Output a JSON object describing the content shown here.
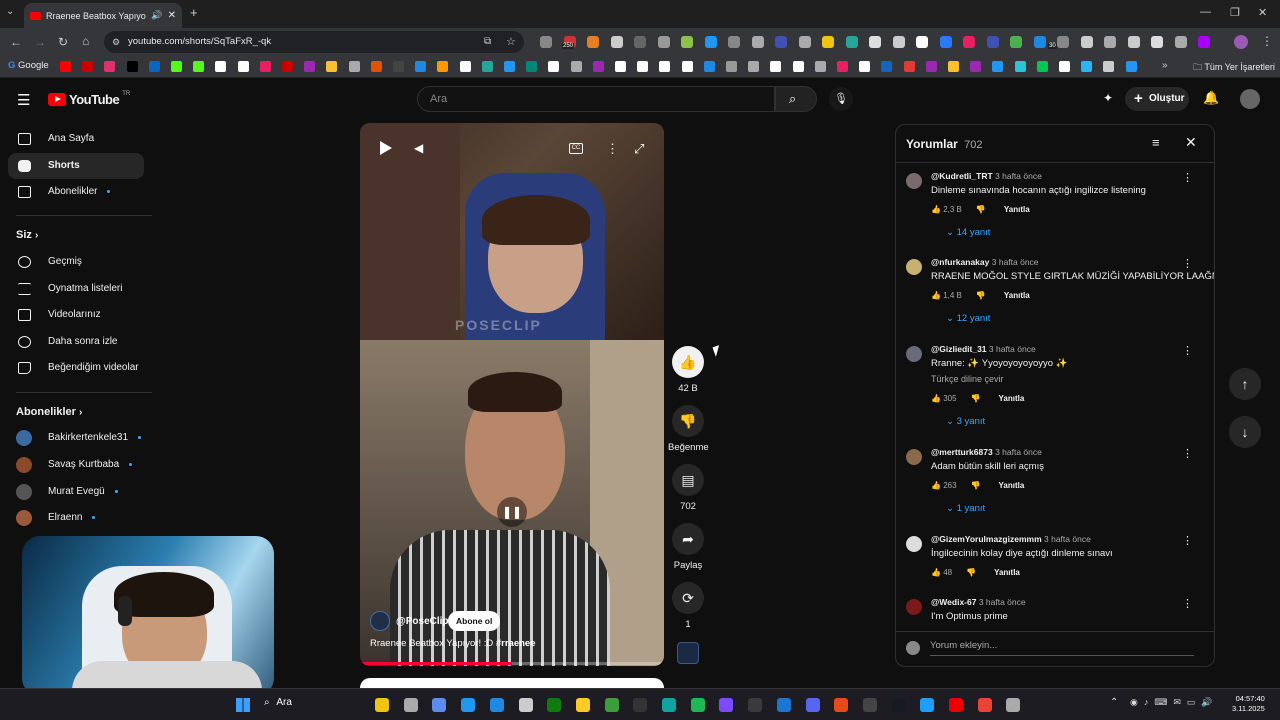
{
  "browser": {
    "tab_title": "Rraenee Beatbox Yapıyor! :D",
    "url": "youtube.com/shorts/SqTaFxR_-qk",
    "bookmark_first": "Google",
    "bookmark_folder": "Tüm Yer İşaretleri",
    "ext_badge_a": "250",
    "ext_badge_b": "30"
  },
  "youtube": {
    "logo_text": "YouTube",
    "logo_region": "TR",
    "search_placeholder": "Ara",
    "create_label": "Oluştur"
  },
  "sidebar": {
    "main": [
      {
        "label": "Ana Sayfa",
        "icon": "home-icon"
      },
      {
        "label": "Shorts",
        "icon": "shorts-icon",
        "active": true
      },
      {
        "label": "Abonelikler",
        "icon": "subscriptions-icon"
      }
    ],
    "you_header": "Siz",
    "you": [
      {
        "label": "Geçmiş",
        "icon": "history-icon"
      },
      {
        "label": "Oynatma listeleri",
        "icon": "playlist-icon"
      },
      {
        "label": "Videolarınız",
        "icon": "your-videos-icon"
      },
      {
        "label": "Daha sonra izle",
        "icon": "watch-later-icon"
      },
      {
        "label": "Beğendiğim videolar",
        "icon": "liked-icon"
      }
    ],
    "subs_header": "Abonelikler",
    "subs": [
      {
        "label": "Bakirkertenkele31",
        "color": "#3b6aa0"
      },
      {
        "label": "Savaş Kurtbaba",
        "color": "#8a4a2a"
      },
      {
        "label": "Murat Evegü",
        "color": "#555555"
      },
      {
        "label": "Elraenn",
        "color": "#9a5a3a"
      }
    ]
  },
  "video": {
    "watermark": "POSECLIP",
    "channel": "@PoseClip",
    "subscribe_label": "Abone ol",
    "caption": "Rraenee Beatbox Yapıyor! :D",
    "hashtag": "#rraenee",
    "progress": 0.5
  },
  "actions": {
    "likes": "42 B",
    "dislike_label": "Beğenme",
    "comments": "702",
    "share_label": "Paylaş",
    "remix": "1"
  },
  "comments_panel": {
    "title": "Yorumlar",
    "count": "702",
    "reply_label": "Yanıtla",
    "add_placeholder": "Yorum ekleyin...",
    "items": [
      {
        "user": "@Kudretli_TRT",
        "time": "3 hafta önce",
        "text": "Dinleme sınavında hocanın açtığı ingilizce listening",
        "likes": "2,3 B",
        "replies": "14 yanıt",
        "color": "#7a6a6a"
      },
      {
        "user": "@nfurkanakay",
        "time": "3 hafta önce",
        "text": "RRAENE MOĞOL STYLE GIRTLAK MÜZİĞİ YAPABİLİYOR LAAĞN",
        "likes": "1,4 B",
        "replies": "12 yanıt",
        "color": "#c8b070"
      },
      {
        "user": "@Gizliedit_31",
        "time": "3 hafta önce",
        "text": "Rranne: ✨ Yyoyoyoyoyoyyo ✨",
        "translate": "Türkçe diline çevir",
        "likes": "305",
        "replies": "3 yanıt",
        "color": "#6a6a7a"
      },
      {
        "user": "@mertturk6873",
        "time": "3 hafta önce",
        "text": "Adam bütün skill leri açmış",
        "likes": "263",
        "replies": "1 yanıt",
        "color": "#8a6a4a"
      },
      {
        "user": "@GizemYorulmazgizemmm",
        "time": "3 hafta önce",
        "text": "İngilcecinin kolay diye açtığı dinleme sınavı",
        "likes": "48",
        "color": "#dddddd"
      },
      {
        "user": "@Wedix-67",
        "time": "3 hafta önce",
        "text": "I'm Optimus prime",
        "color": "#7a1a1a"
      }
    ]
  },
  "taskbar": {
    "search_label": "Ara",
    "time": "04:57:40",
    "date": "3.11.2025"
  }
}
